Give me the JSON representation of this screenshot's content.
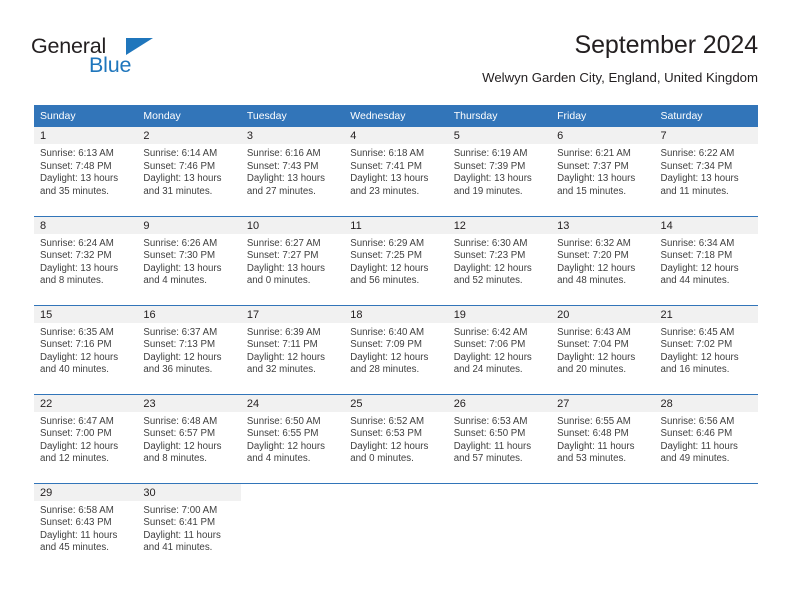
{
  "brand": {
    "name_top": "General",
    "name_bottom": "Blue",
    "accent_color": "#1f76bc"
  },
  "header": {
    "title": "September 2024",
    "subtitle": "Welwyn Garden City, England, United Kingdom"
  },
  "theme": {
    "header_blue": "#3275b9",
    "daynum_gray": "#f1f1f1",
    "text": "#231f20"
  },
  "weekday_headers": [
    "Sunday",
    "Monday",
    "Tuesday",
    "Wednesday",
    "Thursday",
    "Friday",
    "Saturday"
  ],
  "weeks": [
    [
      {
        "day": "1",
        "sunrise": "Sunrise: 6:13 AM",
        "sunset": "Sunset: 7:48 PM",
        "daylight_line1": "Daylight: 13 hours",
        "daylight_line2": "and 35 minutes."
      },
      {
        "day": "2",
        "sunrise": "Sunrise: 6:14 AM",
        "sunset": "Sunset: 7:46 PM",
        "daylight_line1": "Daylight: 13 hours",
        "daylight_line2": "and 31 minutes."
      },
      {
        "day": "3",
        "sunrise": "Sunrise: 6:16 AM",
        "sunset": "Sunset: 7:43 PM",
        "daylight_line1": "Daylight: 13 hours",
        "daylight_line2": "and 27 minutes."
      },
      {
        "day": "4",
        "sunrise": "Sunrise: 6:18 AM",
        "sunset": "Sunset: 7:41 PM",
        "daylight_line1": "Daylight: 13 hours",
        "daylight_line2": "and 23 minutes."
      },
      {
        "day": "5",
        "sunrise": "Sunrise: 6:19 AM",
        "sunset": "Sunset: 7:39 PM",
        "daylight_line1": "Daylight: 13 hours",
        "daylight_line2": "and 19 minutes."
      },
      {
        "day": "6",
        "sunrise": "Sunrise: 6:21 AM",
        "sunset": "Sunset: 7:37 PM",
        "daylight_line1": "Daylight: 13 hours",
        "daylight_line2": "and 15 minutes."
      },
      {
        "day": "7",
        "sunrise": "Sunrise: 6:22 AM",
        "sunset": "Sunset: 7:34 PM",
        "daylight_line1": "Daylight: 13 hours",
        "daylight_line2": "and 11 minutes."
      }
    ],
    [
      {
        "day": "8",
        "sunrise": "Sunrise: 6:24 AM",
        "sunset": "Sunset: 7:32 PM",
        "daylight_line1": "Daylight: 13 hours",
        "daylight_line2": "and 8 minutes."
      },
      {
        "day": "9",
        "sunrise": "Sunrise: 6:26 AM",
        "sunset": "Sunset: 7:30 PM",
        "daylight_line1": "Daylight: 13 hours",
        "daylight_line2": "and 4 minutes."
      },
      {
        "day": "10",
        "sunrise": "Sunrise: 6:27 AM",
        "sunset": "Sunset: 7:27 PM",
        "daylight_line1": "Daylight: 13 hours",
        "daylight_line2": "and 0 minutes."
      },
      {
        "day": "11",
        "sunrise": "Sunrise: 6:29 AM",
        "sunset": "Sunset: 7:25 PM",
        "daylight_line1": "Daylight: 12 hours",
        "daylight_line2": "and 56 minutes."
      },
      {
        "day": "12",
        "sunrise": "Sunrise: 6:30 AM",
        "sunset": "Sunset: 7:23 PM",
        "daylight_line1": "Daylight: 12 hours",
        "daylight_line2": "and 52 minutes."
      },
      {
        "day": "13",
        "sunrise": "Sunrise: 6:32 AM",
        "sunset": "Sunset: 7:20 PM",
        "daylight_line1": "Daylight: 12 hours",
        "daylight_line2": "and 48 minutes."
      },
      {
        "day": "14",
        "sunrise": "Sunrise: 6:34 AM",
        "sunset": "Sunset: 7:18 PM",
        "daylight_line1": "Daylight: 12 hours",
        "daylight_line2": "and 44 minutes."
      }
    ],
    [
      {
        "day": "15",
        "sunrise": "Sunrise: 6:35 AM",
        "sunset": "Sunset: 7:16 PM",
        "daylight_line1": "Daylight: 12 hours",
        "daylight_line2": "and 40 minutes."
      },
      {
        "day": "16",
        "sunrise": "Sunrise: 6:37 AM",
        "sunset": "Sunset: 7:13 PM",
        "daylight_line1": "Daylight: 12 hours",
        "daylight_line2": "and 36 minutes."
      },
      {
        "day": "17",
        "sunrise": "Sunrise: 6:39 AM",
        "sunset": "Sunset: 7:11 PM",
        "daylight_line1": "Daylight: 12 hours",
        "daylight_line2": "and 32 minutes."
      },
      {
        "day": "18",
        "sunrise": "Sunrise: 6:40 AM",
        "sunset": "Sunset: 7:09 PM",
        "daylight_line1": "Daylight: 12 hours",
        "daylight_line2": "and 28 minutes."
      },
      {
        "day": "19",
        "sunrise": "Sunrise: 6:42 AM",
        "sunset": "Sunset: 7:06 PM",
        "daylight_line1": "Daylight: 12 hours",
        "daylight_line2": "and 24 minutes."
      },
      {
        "day": "20",
        "sunrise": "Sunrise: 6:43 AM",
        "sunset": "Sunset: 7:04 PM",
        "daylight_line1": "Daylight: 12 hours",
        "daylight_line2": "and 20 minutes."
      },
      {
        "day": "21",
        "sunrise": "Sunrise: 6:45 AM",
        "sunset": "Sunset: 7:02 PM",
        "daylight_line1": "Daylight: 12 hours",
        "daylight_line2": "and 16 minutes."
      }
    ],
    [
      {
        "day": "22",
        "sunrise": "Sunrise: 6:47 AM",
        "sunset": "Sunset: 7:00 PM",
        "daylight_line1": "Daylight: 12 hours",
        "daylight_line2": "and 12 minutes."
      },
      {
        "day": "23",
        "sunrise": "Sunrise: 6:48 AM",
        "sunset": "Sunset: 6:57 PM",
        "daylight_line1": "Daylight: 12 hours",
        "daylight_line2": "and 8 minutes."
      },
      {
        "day": "24",
        "sunrise": "Sunrise: 6:50 AM",
        "sunset": "Sunset: 6:55 PM",
        "daylight_line1": "Daylight: 12 hours",
        "daylight_line2": "and 4 minutes."
      },
      {
        "day": "25",
        "sunrise": "Sunrise: 6:52 AM",
        "sunset": "Sunset: 6:53 PM",
        "daylight_line1": "Daylight: 12 hours",
        "daylight_line2": "and 0 minutes."
      },
      {
        "day": "26",
        "sunrise": "Sunrise: 6:53 AM",
        "sunset": "Sunset: 6:50 PM",
        "daylight_line1": "Daylight: 11 hours",
        "daylight_line2": "and 57 minutes."
      },
      {
        "day": "27",
        "sunrise": "Sunrise: 6:55 AM",
        "sunset": "Sunset: 6:48 PM",
        "daylight_line1": "Daylight: 11 hours",
        "daylight_line2": "and 53 minutes."
      },
      {
        "day": "28",
        "sunrise": "Sunrise: 6:56 AM",
        "sunset": "Sunset: 6:46 PM",
        "daylight_line1": "Daylight: 11 hours",
        "daylight_line2": "and 49 minutes."
      }
    ],
    [
      {
        "day": "29",
        "sunrise": "Sunrise: 6:58 AM",
        "sunset": "Sunset: 6:43 PM",
        "daylight_line1": "Daylight: 11 hours",
        "daylight_line2": "and 45 minutes."
      },
      {
        "day": "30",
        "sunrise": "Sunrise: 7:00 AM",
        "sunset": "Sunset: 6:41 PM",
        "daylight_line1": "Daylight: 11 hours",
        "daylight_line2": "and 41 minutes."
      },
      {
        "day": "",
        "sunrise": "",
        "sunset": "",
        "daylight_line1": "",
        "daylight_line2": ""
      },
      {
        "day": "",
        "sunrise": "",
        "sunset": "",
        "daylight_line1": "",
        "daylight_line2": ""
      },
      {
        "day": "",
        "sunrise": "",
        "sunset": "",
        "daylight_line1": "",
        "daylight_line2": ""
      },
      {
        "day": "",
        "sunrise": "",
        "sunset": "",
        "daylight_line1": "",
        "daylight_line2": ""
      },
      {
        "day": "",
        "sunrise": "",
        "sunset": "",
        "daylight_line1": "",
        "daylight_line2": ""
      }
    ]
  ]
}
